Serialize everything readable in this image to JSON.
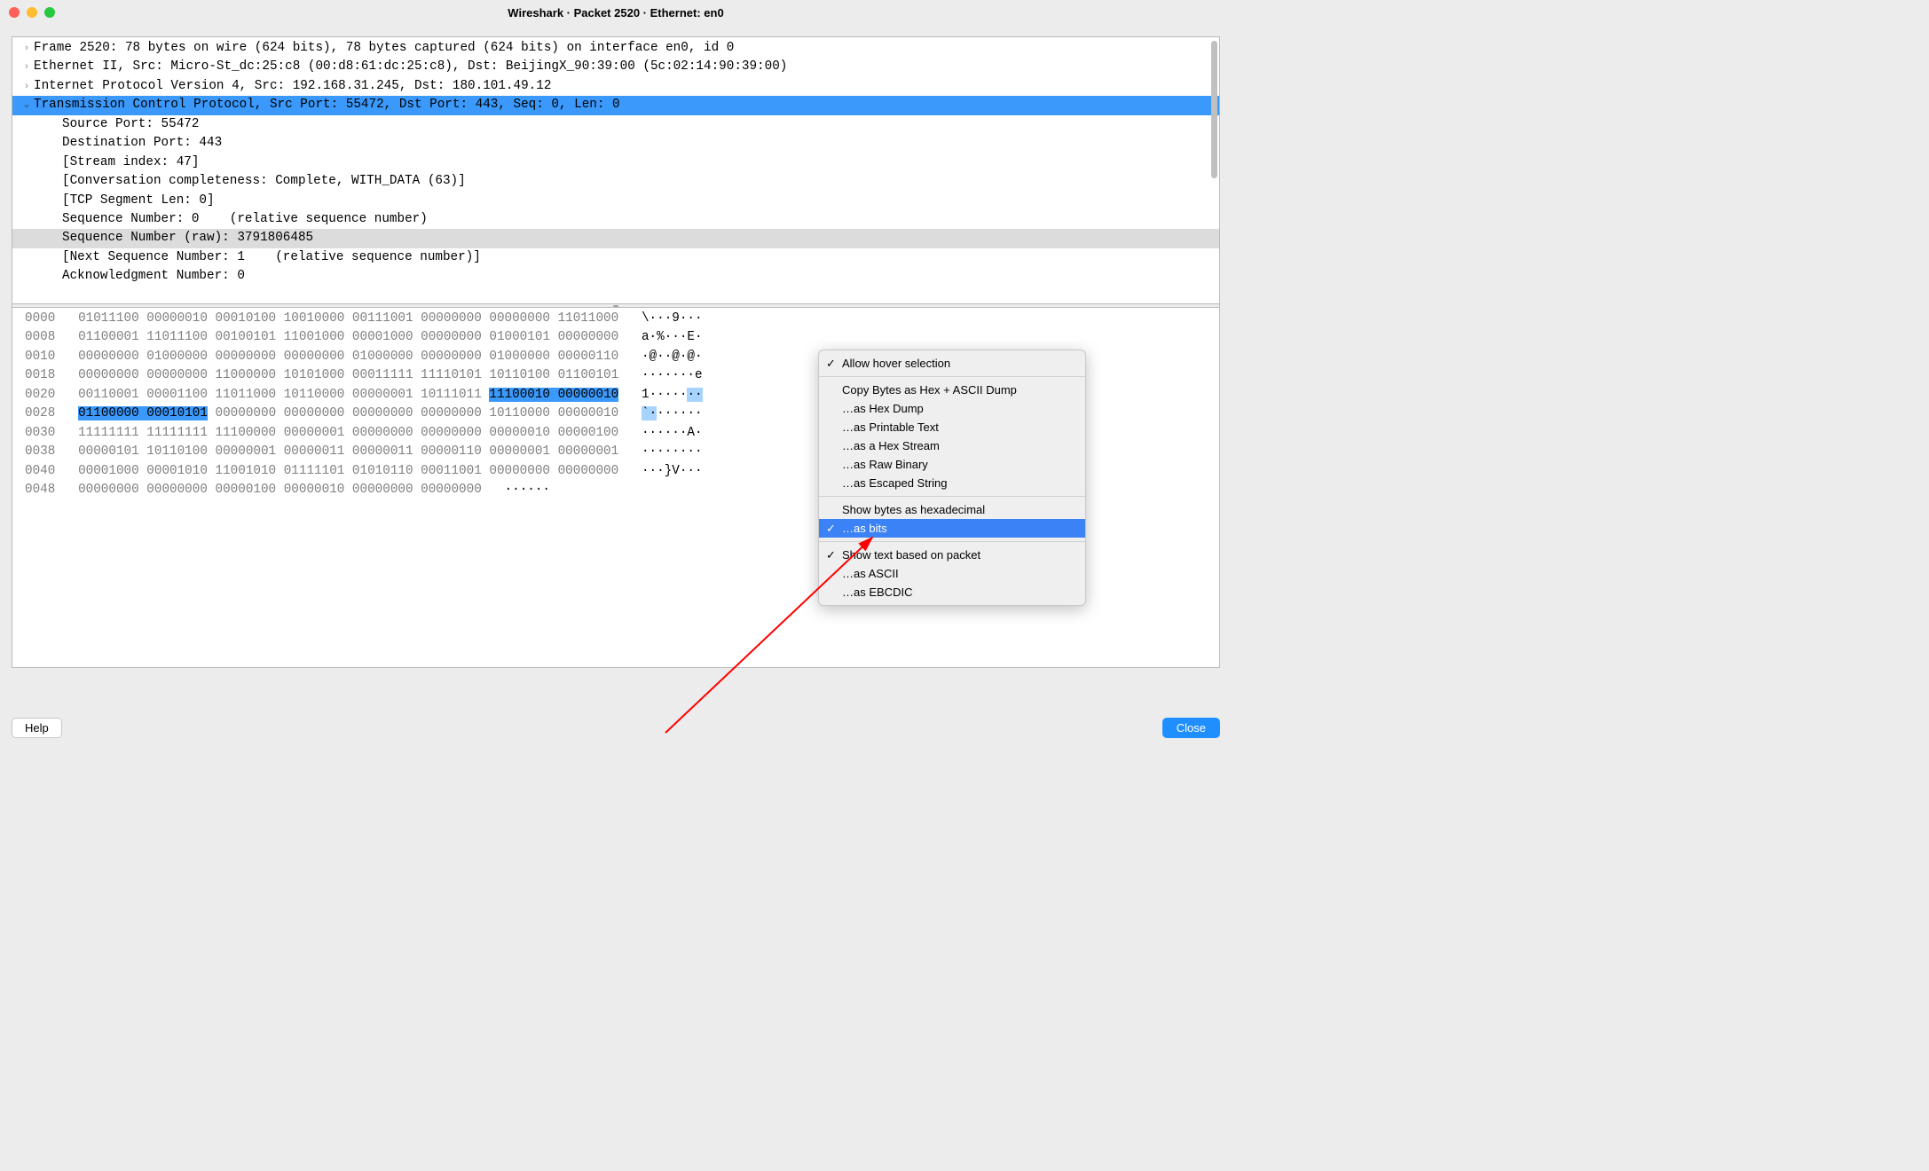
{
  "window": {
    "title": "Wireshark · Packet 2520 · Ethernet: en0"
  },
  "tree": {
    "frame": "Frame 2520: 78 bytes on wire (624 bits), 78 bytes captured (624 bits) on interface en0, id 0",
    "eth": "Ethernet II, Src: Micro-St_dc:25:c8 (00:d8:61:dc:25:c8), Dst: BeijingX_90:39:00 (5c:02:14:90:39:00)",
    "ip": "Internet Protocol Version 4, Src: 192.168.31.245, Dst: 180.101.49.12",
    "tcp": "Transmission Control Protocol, Src Port: 55472, Dst Port: 443, Seq: 0, Len: 0",
    "srcport": "Source Port: 55472",
    "dstport": "Destination Port: 443",
    "stream": "[Stream index: 47]",
    "conv": "[Conversation completeness: Complete, WITH_DATA (63)]",
    "seglen": "[TCP Segment Len: 0]",
    "seqnum": "Sequence Number: 0    (relative sequence number)",
    "seqraw": "Sequence Number (raw): 3791806485",
    "nextseq": "[Next Sequence Number: 1    (relative sequence number)]",
    "acknum": "Acknowledgment Number: 0"
  },
  "hex": {
    "rows": [
      {
        "off": "0000",
        "b": "01011100 00000010 00010100 10010000 00111001 00000000 00000000 11011000",
        "a": "\\···9···"
      },
      {
        "off": "0008",
        "b": "01100001 11011100 00100101 11001000 00001000 00000000 01000101 00000000",
        "a": "a·%···E·"
      },
      {
        "off": "0010",
        "b": "00000000 01000000 00000000 00000000 01000000 00000000 01000000 00000110",
        "a": "·@··@·@·"
      },
      {
        "off": "0018",
        "b": "00000000 00000000 11000000 10101000 00011111 11110101 10110100 01100101",
        "a": "·······e"
      },
      {
        "off": "0020",
        "b": "00110001 00001100 11011000 10110000 00000001 10111011 ",
        "bsel": "11100010 00000010",
        "a": "1·····",
        "asel": "··"
      },
      {
        "off": "0028",
        "bsel": "01100000 00010101",
        "b": " 00000000 00000000 00000000 00000000 10110000 00000010",
        "asel": "`·",
        "a": "······"
      },
      {
        "off": "0030",
        "b": "11111111 11111111 11100000 00000001 00000000 00000000 00000010 00000100",
        "a": "······A·"
      },
      {
        "off": "0038",
        "b": "00000101 10110100 00000001 00000011 00000011 00000110 00000001 00000001",
        "a": "········"
      },
      {
        "off": "0040",
        "b": "00001000 00001010 11001010 01111101 01010110 00011001 00000000 00000000",
        "a": "···}V···"
      },
      {
        "off": "0048",
        "b": "00000000 00000000 00000100 00000010 00000000 00000000",
        "a": "······  "
      }
    ]
  },
  "menu": {
    "items": [
      {
        "label": "Allow hover selection",
        "checked": true
      },
      {
        "sep": true
      },
      {
        "label": "Copy Bytes as Hex + ASCII Dump"
      },
      {
        "label": "…as Hex Dump"
      },
      {
        "label": "…as Printable Text"
      },
      {
        "label": "…as a Hex Stream"
      },
      {
        "label": "…as Raw Binary"
      },
      {
        "label": "…as Escaped String"
      },
      {
        "sep": true
      },
      {
        "label": "Show bytes as hexadecimal"
      },
      {
        "label": "…as bits",
        "checked": true,
        "highlighted": true
      },
      {
        "sep": true
      },
      {
        "label": "Show text based on packet",
        "checked": true
      },
      {
        "label": "…as ASCII"
      },
      {
        "label": "…as EBCDIC"
      }
    ]
  },
  "buttons": {
    "help": "Help",
    "close": "Close"
  }
}
